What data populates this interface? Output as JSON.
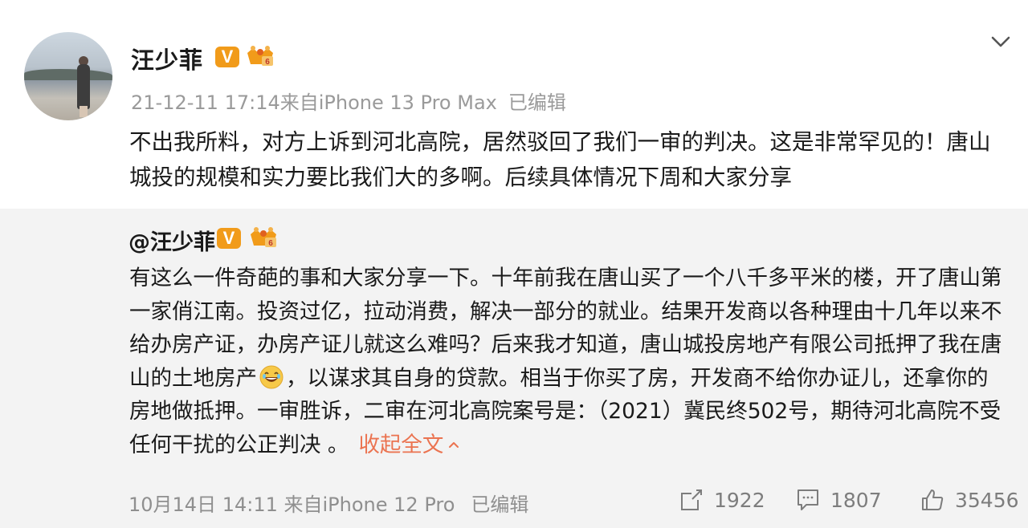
{
  "post": {
    "author": "汪少菲",
    "verified_badge": "V",
    "time": "21-12-11 17:14",
    "source": "来自iPhone 13 Pro Max",
    "edited": "已编辑",
    "text": "不出我所料，对方上诉到河北高院，居然驳回了我们一审的判决。这是非常罕见的！唐山城投的规模和实力要比我们大的多啊。后续具体情况下周和大家分享"
  },
  "repost": {
    "author": "@汪少菲",
    "verified_badge": "V",
    "text_part1": "有这么一件奇葩的事和大家分享一下。十年前我在唐山买了一个八千多平米的楼，开了唐山第一家俏江南。投资过亿，拉动消费，解决一部分的就业。结果开发商以各种理由十几年以来不给办房产证，办房产证儿就这么难吗？后来我才知道，唐山城投房地产有限公司抵押了我在唐山的土地房产",
    "text_part2": "，以谋求其自身的贷款。相当于你买了房，开发商不给你办证儿，还拿你的房地做抵押。一审胜诉，二审在河北高院案号是：（2021）冀民终502号，期待河北高院不受任何干扰的公正判决 。",
    "collapse_label": "收起全文",
    "time": "10月14日 14:11",
    "source": "来自iPhone 12 Pro",
    "edited": "已编辑",
    "reposts": "1922",
    "comments": "1807",
    "likes": "35456"
  },
  "colors": {
    "accent": "#eb7350",
    "badge": "#f19b1a",
    "meta": "#9a9a9a",
    "repost_bg": "#f3f3f3"
  },
  "icons": [
    "chevron-down-icon",
    "verified-v-icon",
    "vip-crown-icon",
    "laugh-emoji-icon",
    "repost-icon",
    "comment-icon",
    "like-icon"
  ]
}
